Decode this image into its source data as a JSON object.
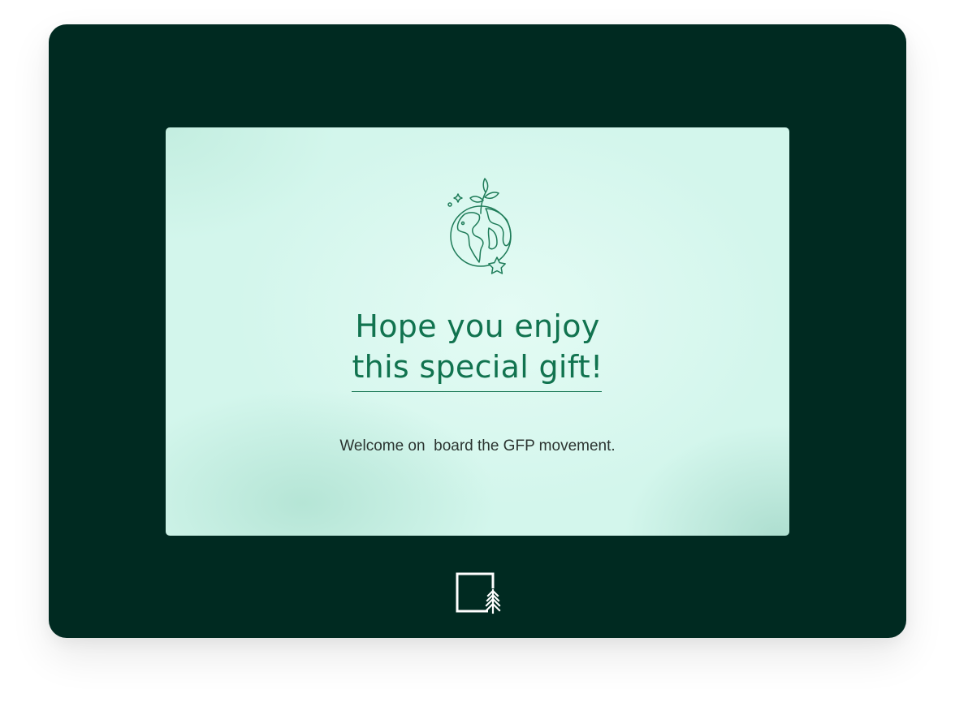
{
  "card": {
    "heading_line1": "Hope you enjoy",
    "heading_line2": "this special gift!",
    "message": "Welcome on  board the GFP movement."
  },
  "icons": {
    "illustration": "earth-with-sprout-icon",
    "brand": "tree-frame-logo"
  },
  "colors": {
    "frame_background": "#002a21",
    "card_background": "#dcf9f0",
    "heading_green": "#11734f",
    "body_text": "#2b3430",
    "logo_white": "#ffffff"
  }
}
